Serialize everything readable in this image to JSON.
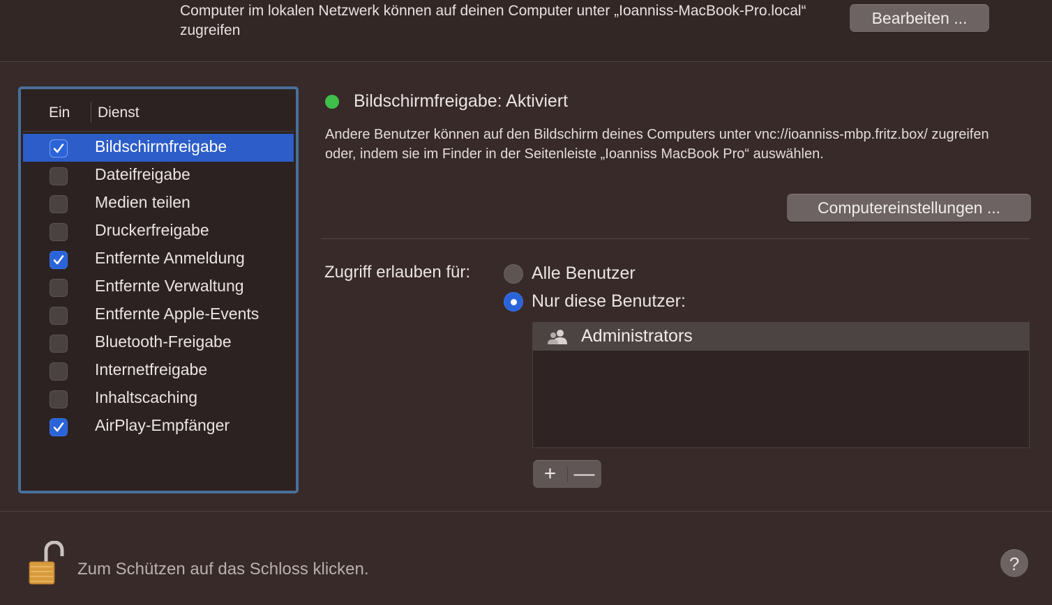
{
  "header": {
    "network_text": "Computer im lokalen Netzwerk können auf deinen Computer unter „Ioanniss-MacBook-Pro.local“ zugreifen",
    "edit_button": "Bearbeiten ..."
  },
  "services": {
    "col_on": "Ein",
    "col_service": "Dienst",
    "items": [
      {
        "label": "Bildschirmfreigabe",
        "checked": true,
        "selected": true
      },
      {
        "label": "Dateifreigabe",
        "checked": false
      },
      {
        "label": "Medien teilen",
        "checked": false
      },
      {
        "label": "Druckerfreigabe",
        "checked": false
      },
      {
        "label": "Entfernte Anmeldung",
        "checked": true
      },
      {
        "label": "Entfernte Verwaltung",
        "checked": false
      },
      {
        "label": "Entfernte Apple-Events",
        "checked": false
      },
      {
        "label": "Bluetooth-Freigabe",
        "checked": false
      },
      {
        "label": "Internetfreigabe",
        "checked": false
      },
      {
        "label": "Inhaltscaching",
        "checked": false
      },
      {
        "label": "AirPlay-Empfänger",
        "checked": true
      }
    ]
  },
  "detail": {
    "status_title": "Bildschirmfreigabe: Aktiviert",
    "status_color": "#3fc04a",
    "description": "Andere Benutzer können auf den Bildschirm deines Computers unter vnc://ioanniss-mbp.fritz.box/ zugreifen oder, indem sie im Finder in der Seitenleiste „Ioanniss MacBook Pro“ auswählen.",
    "computer_settings_button": "Computereinstellungen ...",
    "access_label": "Zugriff erlauben für:",
    "radio_all": "Alle Benutzer",
    "radio_only": "Nur diese Benutzer:",
    "selected_radio": "only",
    "users": [
      "Administrators"
    ],
    "add_symbol": "+",
    "remove_symbol": "—"
  },
  "footer": {
    "lock_text": "Zum Schützen auf das Schloss klicken.",
    "help_symbol": "?"
  },
  "colors": {
    "accent": "#2b63d9",
    "selection": "#2c5dc9",
    "list_focus_ring": "#486f99"
  }
}
